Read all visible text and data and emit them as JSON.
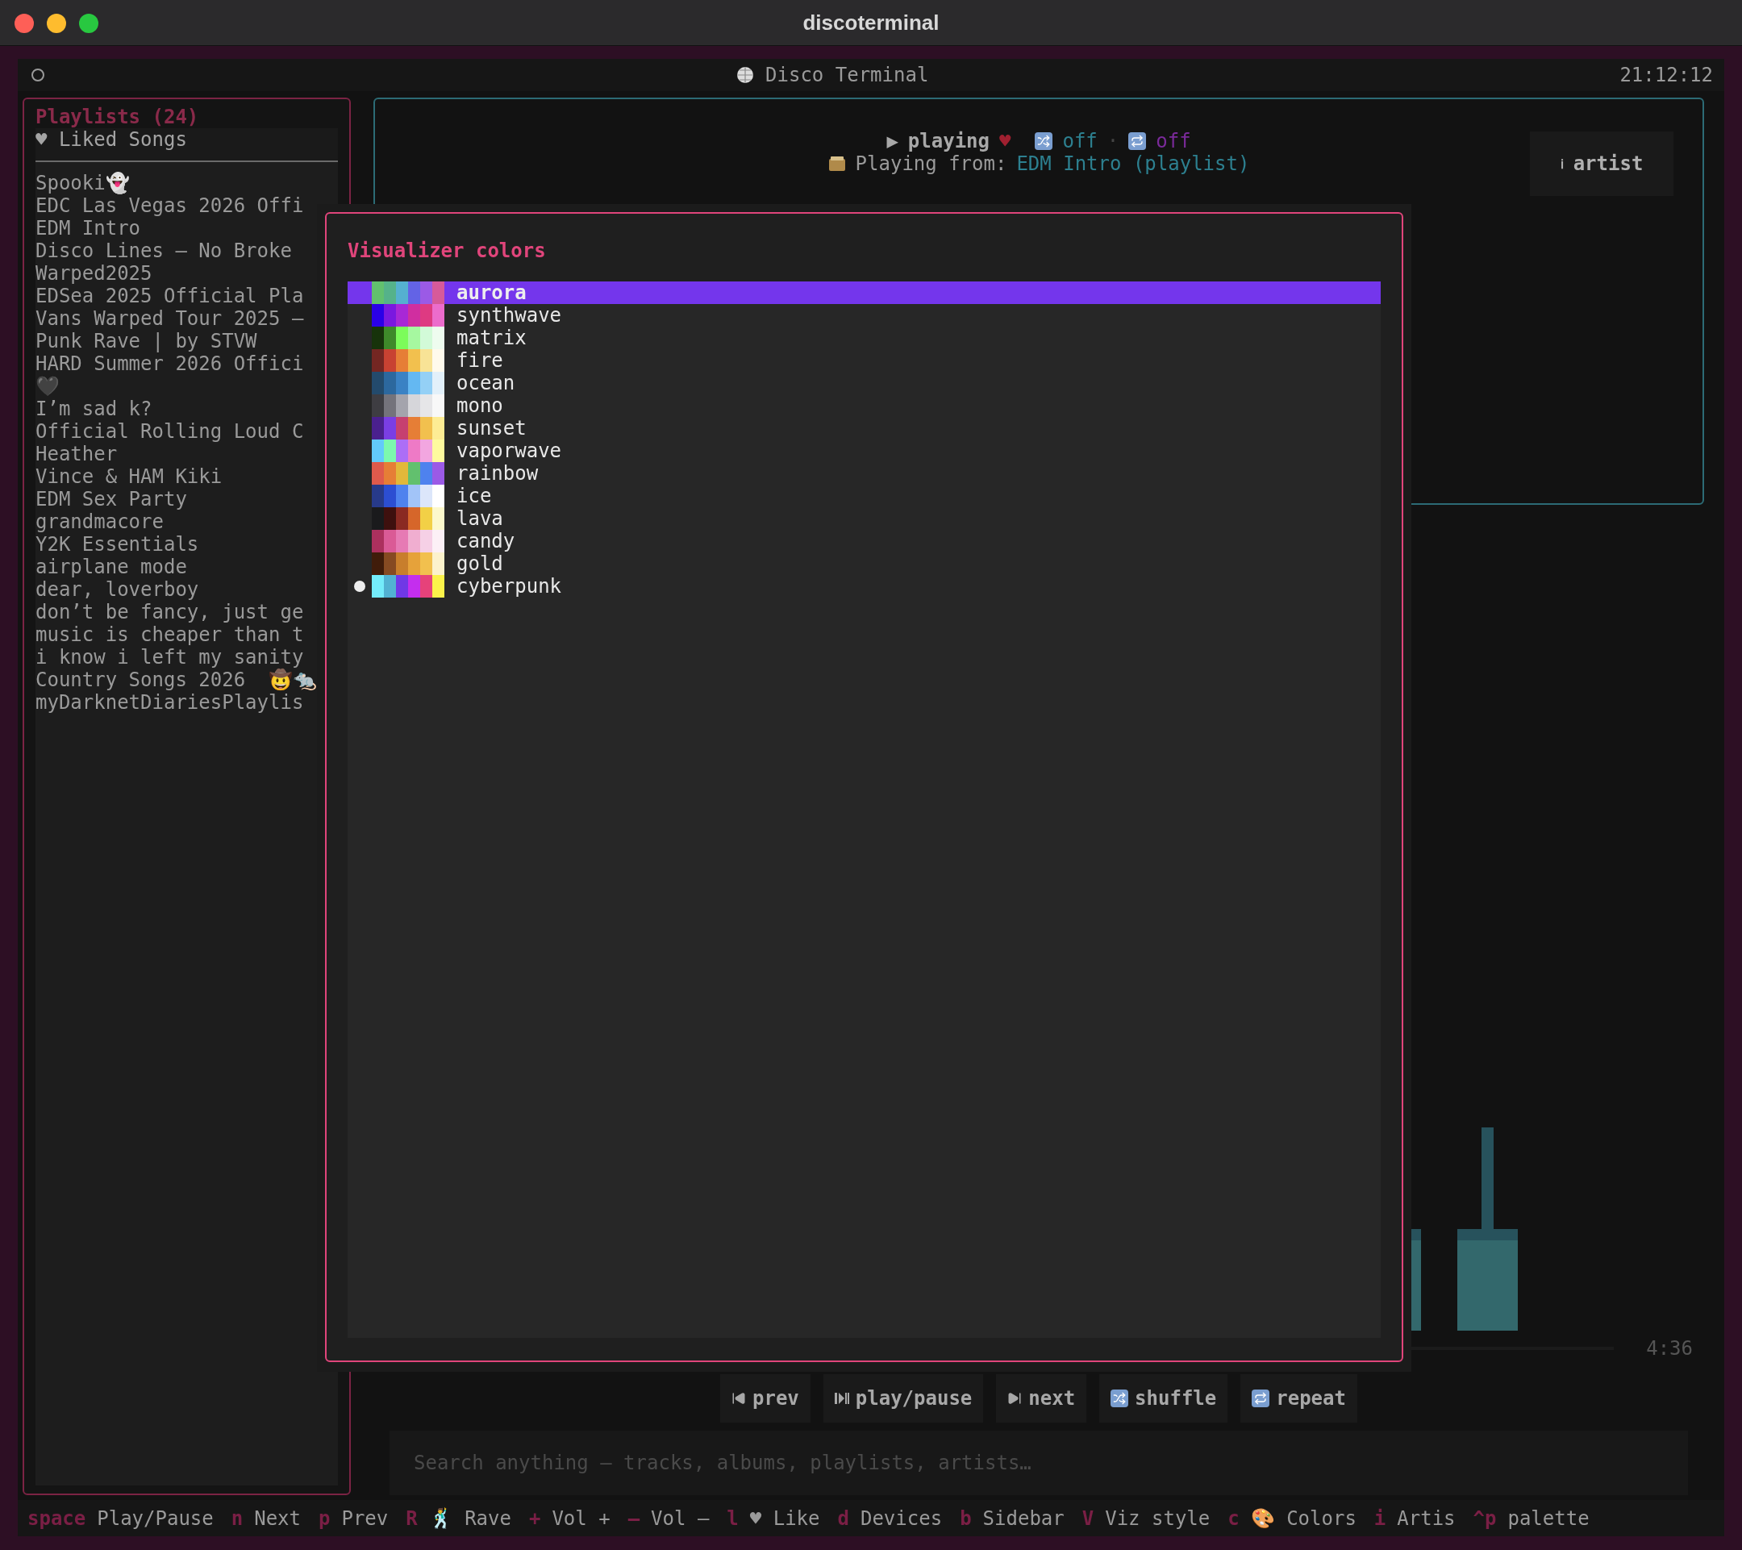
{
  "window": {
    "title": "discoterminal"
  },
  "header": {
    "title": "Disco Terminal",
    "time": "21:12:12"
  },
  "sidebar": {
    "title": "Playlists (24)",
    "liked": "♥ Liked Songs",
    "items": [
      "Spooki👻",
      "EDC Las Vegas 2026 Offi",
      "EDM Intro",
      "Disco Lines – No Broke",
      "Warped2025",
      "EDSea 2025 Official Pla",
      "Vans Warped Tour 2025 –",
      "Punk Rave | by STVW",
      "HARD Summer 2026 Offici",
      "🖤",
      "I’m sad k?",
      "Official Rolling Loud C",
      "Heather",
      "Vince & HAM Kiki",
      "EDM Sex Party",
      "grandmacore",
      "Y2K Essentials",
      "airplane mode",
      "dear, loverboy",
      "don’t be fancy, just ge",
      "music is cheaper than t",
      "i know i left my sanity",
      "Country Songs 2026  🤠🐀",
      "myDarknetDiariesPlaylis"
    ]
  },
  "now_playing": {
    "state_icon": "▶",
    "state": "playing",
    "heart": "♥",
    "shuffle": "off",
    "repeat": "off",
    "separator": "·",
    "from_label": "Playing from:",
    "from_value": "EDM Intro (playlist)",
    "artist_button": {
      "icon": "ℹ",
      "label": "artist"
    }
  },
  "progress": {
    "time": "4:36"
  },
  "controls": [
    {
      "kind": "prev",
      "label": "prev"
    },
    {
      "kind": "playpause",
      "label": "play/pause"
    },
    {
      "kind": "next",
      "label": "next"
    },
    {
      "kind": "shuffle",
      "label": "shuffle"
    },
    {
      "kind": "repeat",
      "label": "repeat"
    }
  ],
  "search": {
    "placeholder": "Search anything — tracks, albums, playlists, artists…"
  },
  "modal": {
    "title": "Visualizer colors",
    "schemes": [
      {
        "name": "aurora",
        "selected": true,
        "active": false,
        "swatches": [
          {
            "color": "#62c06e"
          },
          {
            "color": "#55b28a"
          },
          {
            "color": "#55b0d0"
          },
          {
            "color": "#6363e6"
          },
          {
            "color": "#9b5ae6"
          },
          {
            "color": "#d65a9a"
          }
        ]
      },
      {
        "name": "synthwave",
        "selected": false,
        "active": false,
        "swatches": [
          {
            "color": "#2a00e8"
          },
          {
            "color": "#7a18e0"
          },
          {
            "color": "#a828d6"
          },
          {
            "color": "#d02ea0"
          },
          {
            "color": "#de3a82"
          },
          {
            "color": "#ec6ccc"
          }
        ]
      },
      {
        "name": "matrix",
        "selected": false,
        "active": false,
        "swatches": [
          {
            "color": "#17330b"
          },
          {
            "color": "#3e8a2a"
          },
          {
            "color": "#7cfc5a"
          },
          {
            "color": "#a6f8a0"
          },
          {
            "color": "#d2fad8"
          },
          {
            "color": "#eefcef"
          }
        ]
      },
      {
        "name": "fire",
        "selected": false,
        "active": false,
        "swatches": [
          {
            "color": "#742622"
          },
          {
            "color": "#c84232"
          },
          {
            "color": "#e67e36"
          },
          {
            "color": "#f2c04e"
          },
          {
            "color": "#f8e396"
          },
          {
            "color": "#fffaec"
          }
        ]
      },
      {
        "name": "ocean",
        "selected": false,
        "active": false,
        "swatches": [
          {
            "color": "#234a6c"
          },
          {
            "color": "#2c689e"
          },
          {
            "color": "#3a82c4"
          },
          {
            "color": "#64b8f2"
          },
          {
            "color": "#94d0f6"
          },
          {
            "color": "#e2f0fa"
          }
        ]
      },
      {
        "name": "mono",
        "selected": false,
        "active": false,
        "swatches": [
          {
            "color": "#3e3d42"
          },
          {
            "color": "#74737b"
          },
          {
            "color": "#a4a4ac"
          },
          {
            "color": "#d6d6da"
          },
          {
            "color": "#e6e6e8"
          },
          {
            "color": "#f8f8f8"
          }
        ]
      },
      {
        "name": "sunset",
        "selected": false,
        "active": false,
        "swatches": [
          {
            "color": "#4a208e"
          },
          {
            "color": "#7a3ee4"
          },
          {
            "color": "#c64070"
          },
          {
            "color": "#e67e36"
          },
          {
            "color": "#f2c04e"
          },
          {
            "color": "#fdec94"
          }
        ]
      },
      {
        "name": "vaporwave",
        "selected": false,
        "active": false,
        "swatches": [
          {
            "color": "#62cafa"
          },
          {
            "color": "#7cf8ae"
          },
          {
            "color": "#ac6ef6"
          },
          {
            "color": "#ee7ac6"
          },
          {
            "color": "#f2a6e0"
          },
          {
            "color": "#fefa9e"
          }
        ]
      },
      {
        "name": "rainbow",
        "selected": false,
        "active": false,
        "swatches": [
          {
            "color": "#de5a4c"
          },
          {
            "color": "#e67e36"
          },
          {
            "color": "#e2b83a"
          },
          {
            "color": "#62c06e"
          },
          {
            "color": "#4e82ee"
          },
          {
            "color": "#9b5ae6"
          }
        ]
      },
      {
        "name": "ice",
        "selected": false,
        "active": false,
        "swatches": [
          {
            "color": "#273a8a"
          },
          {
            "color": "#2c4ed2"
          },
          {
            "color": "#4e82ee"
          },
          {
            "color": "#a2c4f8"
          },
          {
            "color": "#dce6fa"
          },
          {
            "color": "#ffffff"
          }
        ]
      },
      {
        "name": "lava",
        "selected": false,
        "active": false,
        "swatches": [
          {
            "color": "#1a1a1c"
          },
          {
            "color": "#3e100e"
          },
          {
            "color": "#8a2a22"
          },
          {
            "color": "#d6662a"
          },
          {
            "color": "#f2d046"
          },
          {
            "color": "#fcf8cc"
          }
        ]
      },
      {
        "name": "candy",
        "selected": false,
        "active": false,
        "swatches": [
          {
            "color": "#ac305e"
          },
          {
            "color": "#da5a96"
          },
          {
            "color": "#e67ab4"
          },
          {
            "color": "#f0aed0"
          },
          {
            "color": "#f6d0e6"
          },
          {
            "color": "#fcf0f6"
          }
        ]
      },
      {
        "name": "gold",
        "selected": false,
        "active": false,
        "swatches": [
          {
            "color": "#401c0a"
          },
          {
            "color": "#864a22"
          },
          {
            "color": "#c87e2c"
          },
          {
            "color": "#e6a23a"
          },
          {
            "color": "#f2c04e"
          },
          {
            "color": "#fcf2cc"
          }
        ]
      },
      {
        "name": "cyberpunk",
        "selected": false,
        "active": true,
        "swatches": [
          {
            "color": "#74ecfa"
          },
          {
            "color": "#52b2d2"
          },
          {
            "color": "#7038e6"
          },
          {
            "color": "#c42eee"
          },
          {
            "color": "#e6427a"
          },
          {
            "color": "#fcf24a"
          }
        ]
      }
    ]
  },
  "status_bar": [
    {
      "key": "space",
      "label": "Play/Pause"
    },
    {
      "key": "n",
      "label": "Next"
    },
    {
      "key": "p",
      "label": "Prev"
    },
    {
      "key": "R",
      "label": "🕺 Rave"
    },
    {
      "key": "+",
      "label": "Vol +"
    },
    {
      "key": "–",
      "label": "Vol –"
    },
    {
      "key": "l",
      "label": "♥ Like"
    },
    {
      "key": "d",
      "label": "Devices"
    },
    {
      "key": "b",
      "label": "Sidebar"
    },
    {
      "key": "V",
      "label": "Viz style"
    },
    {
      "key": "c",
      "label": "🎨 Colors"
    },
    {
      "key": "i",
      "label": "Artis"
    },
    {
      "key": "^p",
      "label": "palette"
    }
  ]
}
